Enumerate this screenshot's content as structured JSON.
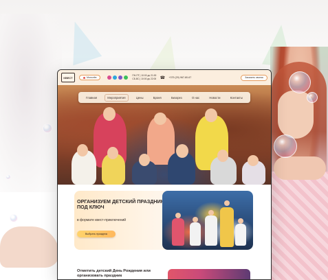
{
  "site": {
    "logo_text": "КВЕСТ",
    "city_label": "Могилёв",
    "hours_line1": "ПН-ПТ | 10:00 до 21:00",
    "hours_line2": "СБ-ВС | 10:00 до 22:00",
    "phone": "+375 (29) 967-80-67",
    "call_button": "Заказать звонок"
  },
  "nav": {
    "items": [
      "Главная",
      "Мероприятия",
      "Цены",
      "Броня",
      "Бизорез",
      "О нас",
      "Новости",
      "Контакты"
    ],
    "active_index": 1
  },
  "promo": {
    "title": "Организуем детский праздник под ключ",
    "subtitle": "в формате квест-приключений",
    "button": "Выбрать праздник"
  },
  "bottom": {
    "text": "Отметить детский День Рождения или организовать праздник"
  },
  "colors": {
    "header_bg": "#fbeede",
    "accent_button": "#ffc45e",
    "outline_accent": "#e59a5b"
  }
}
